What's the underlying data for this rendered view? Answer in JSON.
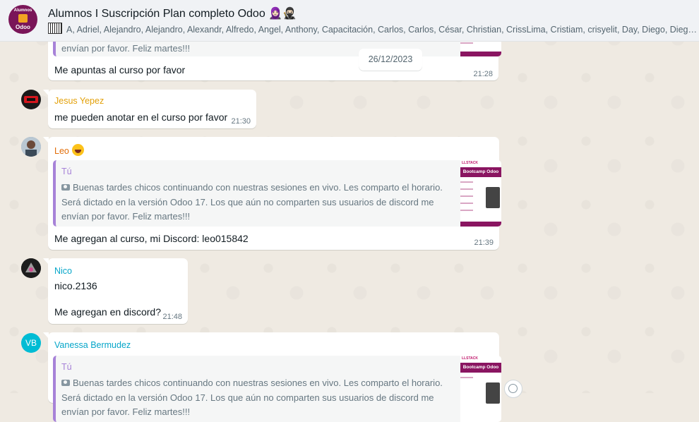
{
  "header": {
    "title": "Alumnos I Suscripción Plan completo Odoo 🧕🏻🥷🏻",
    "avatar_line1": "Alumnos",
    "avatar_line2": "Odoo",
    "members_icon": "piano-icon",
    "members": "A, Adriel, Alejandro, Alejandro, Alexandr, Alfredo, Angel, Anthony, Capacitación, Carlos, Carlos, César, Christian, CrissLima, Cristiam, crisyelit, Day, Diego, Diego, Domingo"
  },
  "date_separator": "26/12/2023",
  "quoted_post": {
    "sender": "Tú",
    "camera_icon": "camera-icon",
    "text": "Buenas tardes chicos continuando con nuestras sesiones en vivo. Les comparto el horario. Será dictado en la versión Odoo 17. Los que aún no comparten sus usuarios de discord me envían por favor. Feliz martes!!!",
    "tail_text": "envían por favor. Feliz martes!!!",
    "thumb_title": "Bootcamp Odoo",
    "thumb_brand": "LLSTACK"
  },
  "messages": [
    {
      "id": "m0",
      "text": "Me apuntas al curso por favor",
      "time": "21:28"
    },
    {
      "id": "m1",
      "sender": "Jesus Yepez",
      "sender_color": "#e3a008",
      "text": "me pueden anotar en el curso por favor",
      "time": "21:30"
    },
    {
      "id": "m2",
      "sender": "Leo",
      "sender_color": "#e26e09",
      "text": "Me agregan al curso, mi Discord: leo015842",
      "time": "21:39"
    },
    {
      "id": "m3",
      "sender": "Nico",
      "sender_color": "#06a6c9",
      "text_line1": "nico.2136",
      "text_line2": "Me agregan en discord?",
      "time": "21:48"
    },
    {
      "id": "m4",
      "sender": "Vanessa Bermudez",
      "sender_color": "#06a6c9",
      "avatar_initials": "VB",
      "avatar_color": "#00bcd4"
    }
  ]
}
